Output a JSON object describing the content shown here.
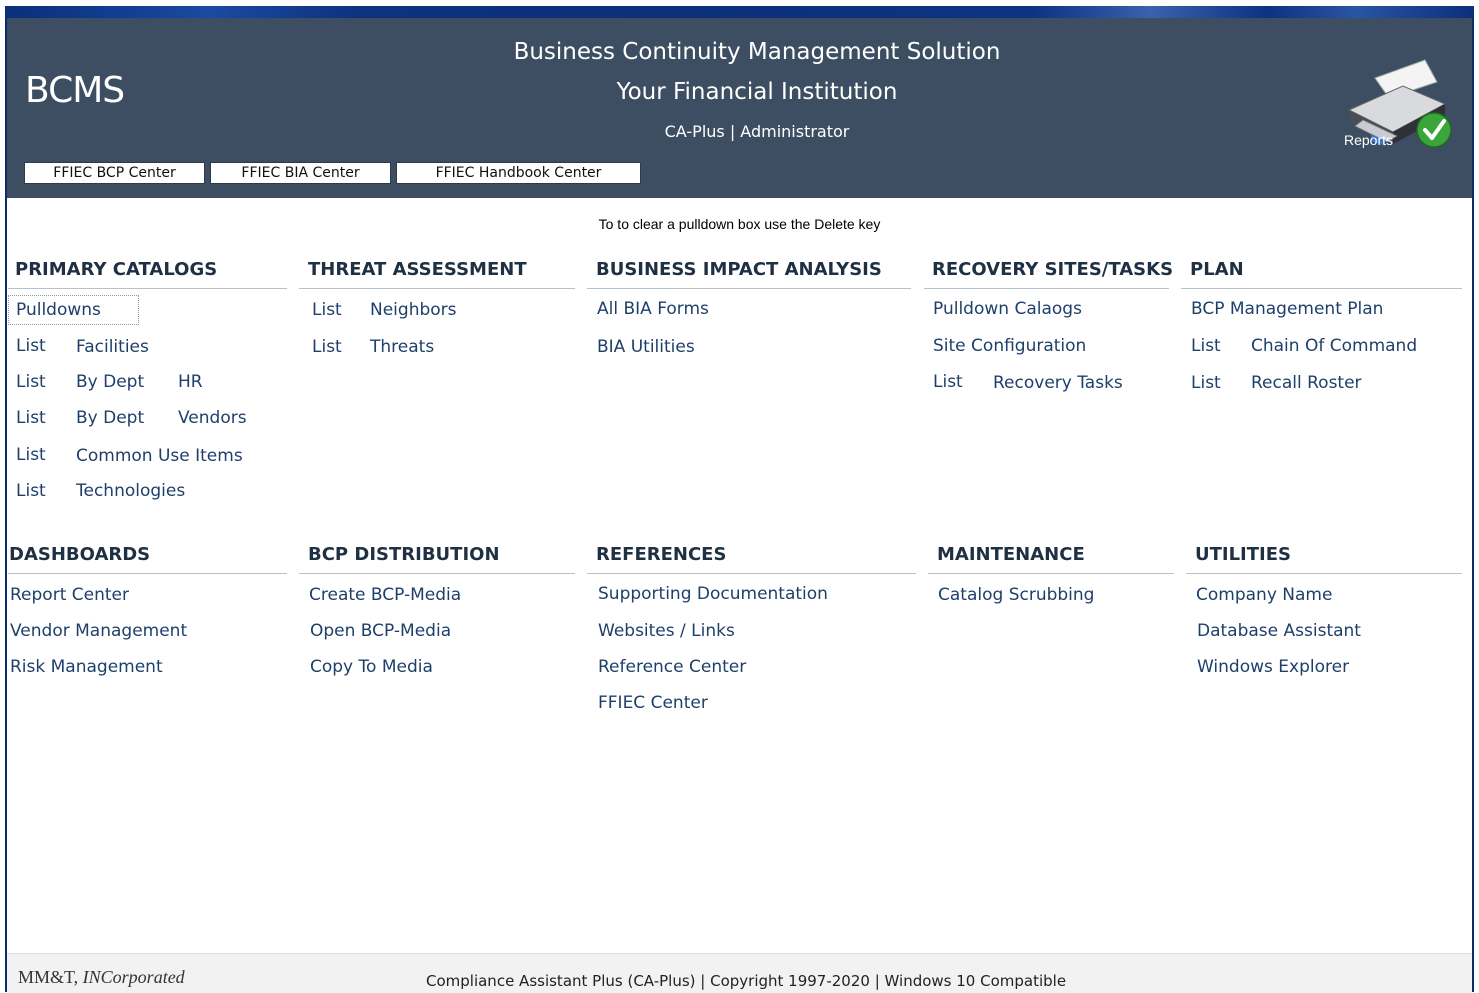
{
  "header": {
    "app_title": "BCMS",
    "solution_title": "Business Continuity Management Solution",
    "institution": "Your Financial Institution",
    "user_line": "CA-Plus | Administrator",
    "buttons": [
      "FFIEC BCP Center",
      "FFIEC BIA Center",
      "FFIEC Handbook Center"
    ],
    "reports_label": "Reports"
  },
  "hint": "To to clear a pulldown box use the Delete key",
  "sections": {
    "primary_catalogs": {
      "title": "PRIMARY CATALOGS",
      "pulldowns": "Pulldowns",
      "list_label": "List",
      "facilities": "Facilities",
      "by_dept": "By Dept",
      "hr": "HR",
      "vendors": "Vendors",
      "common_use_items": "Common Use Items",
      "technologies": "Technologies"
    },
    "threat_assessment": {
      "title": "THREAT ASSESSMENT",
      "list_label": "List",
      "neighbors": "Neighbors",
      "threats": "Threats"
    },
    "business_impact_analysis": {
      "title": "BUSINESS IMPACT ANALYSIS",
      "items": [
        "All BIA Forms",
        "BIA Utilities"
      ]
    },
    "recovery_sites_tasks": {
      "title": "RECOVERY SITES/TASKS",
      "pulldown_catalogs": "Pulldown Calaogs",
      "site_configuration": "Site Configuration",
      "list_label": "List",
      "recovery_tasks": "Recovery Tasks"
    },
    "plan": {
      "title": "PLAN",
      "bcp_management_plan": "BCP Management Plan",
      "list_label": "List",
      "chain_of_command": "Chain Of Command",
      "recall_roster": "Recall Roster"
    },
    "dashboards": {
      "title": "DASHBOARDS",
      "items": [
        "Report Center",
        "Vendor Management",
        "Risk Management"
      ]
    },
    "bcp_distribution": {
      "title": "BCP DISTRIBUTION",
      "items": [
        "Create BCP-Media",
        "Open BCP-Media",
        "Copy To Media"
      ]
    },
    "references": {
      "title": "REFERENCES",
      "items": [
        "Supporting Documentation",
        "Websites / Links",
        "Reference Center",
        "FFIEC Center"
      ]
    },
    "maintenance": {
      "title": "MAINTENANCE",
      "items": [
        "Catalog Scrubbing"
      ]
    },
    "utilities": {
      "title": "UTILITIES",
      "items": [
        "Company Name",
        "Database Assistant",
        "Windows Explorer"
      ]
    }
  },
  "footer": {
    "company_main": "MM&T, ",
    "company_italic": "INCorporated",
    "copyright": "Compliance Assistant Plus (CA-Plus) | Copyright 1997-2020 | Windows 10 Compatible"
  },
  "colors": {
    "header_bg": "#3d4e62",
    "link": "#1f3f6b",
    "heading": "#1f3042"
  },
  "icons": {
    "reports": "printer-with-checkmark-icon"
  }
}
